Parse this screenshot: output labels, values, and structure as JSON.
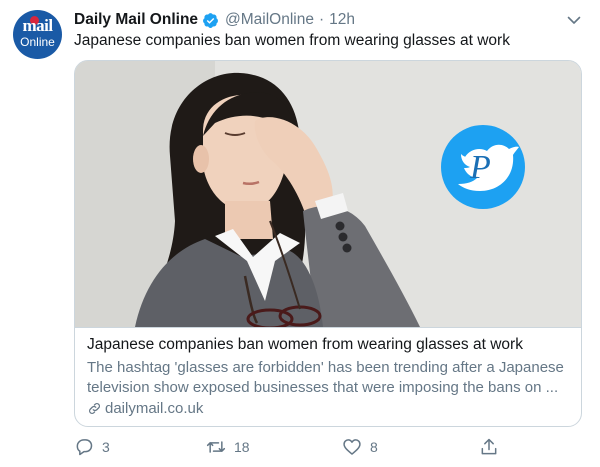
{
  "tweet": {
    "display_name": "Daily Mail Online",
    "handle": "@MailOnline",
    "separator": "·",
    "time": "12h",
    "text": "Japanese companies ban women from wearing glasses at work"
  },
  "avatar": {
    "logo_line1": "mail",
    "logo_line2": "Online",
    "color": "#1a5aa6"
  },
  "card": {
    "title": "Japanese companies ban women from wearing glasses at work",
    "description_line1": "The hashtag 'glasses are forbidden' has been trending after a Japanese",
    "description_line2": "television show exposed businesses that were imposing the bans on ...",
    "domain": "dailymail.co.uk",
    "watermark_letter": "P"
  },
  "actions": {
    "reply_count": "3",
    "retweet_count": "18",
    "like_count": "8"
  },
  "colors": {
    "text_primary": "#14171a",
    "text_secondary": "#657786",
    "verified": "#1da1f2",
    "border": "#ccd6dd"
  },
  "icons": [
    "verified-badge-icon",
    "chevron-down-icon",
    "link-icon",
    "reply-icon",
    "retweet-icon",
    "like-icon",
    "share-icon"
  ]
}
